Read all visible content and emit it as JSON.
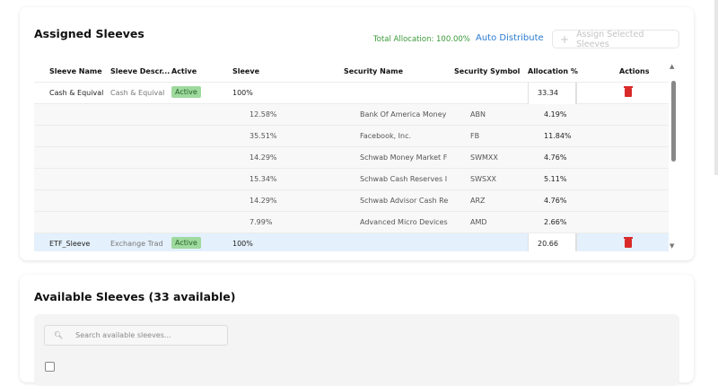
{
  "assigned": {
    "title": "Assigned Sleeves",
    "total_allocation": "Total Allocation: 100.00%",
    "auto_distribute": "Auto Distribute",
    "assign_button": "Assign Selected Sleeves",
    "columns": [
      "Sleeve Name",
      "Sleeve Descr...",
      "Active",
      "Sleeve",
      "Security Name",
      "Security Symbol",
      "Allocation %",
      "Actions"
    ],
    "sleeves": [
      {
        "name": "Cash & Equival",
        "description": "Cash & Equival",
        "status": "Active",
        "sleeve": "100%",
        "allocation": "33.34",
        "securities": [
          {
            "pct": "12.58%",
            "name": "Bank Of America Money",
            "symbol": "ABN",
            "alloc": "4.19%"
          },
          {
            "pct": "35.51%",
            "name": "Facebook, Inc.",
            "symbol": "FB",
            "alloc": "11.84%"
          },
          {
            "pct": "14.29%",
            "name": "Schwab Money Market F",
            "symbol": "SWMXX",
            "alloc": "4.76%"
          },
          {
            "pct": "15.34%",
            "name": "Schwab Cash Reserves I",
            "symbol": "SWSXX",
            "alloc": "5.11%"
          },
          {
            "pct": "14.29%",
            "name": "Schwab Advisor Cash Re",
            "symbol": "ARZ",
            "alloc": "4.76%"
          },
          {
            "pct": "7.99%",
            "name": "Advanced Micro Devices",
            "symbol": "AMD",
            "alloc": "2.66%"
          }
        ]
      },
      {
        "name": "ETF_Sleeve",
        "description": "Exchange Trad",
        "status": "Active",
        "sleeve": "100%",
        "allocation": "20.66"
      }
    ]
  },
  "available": {
    "title": "Available Sleeves (33 available)",
    "search_placeholder": "Search available sleeves..."
  },
  "colors": {
    "accent": "#2a7bd0",
    "success": "#3a9a3a",
    "danger": "#d92a2a"
  }
}
